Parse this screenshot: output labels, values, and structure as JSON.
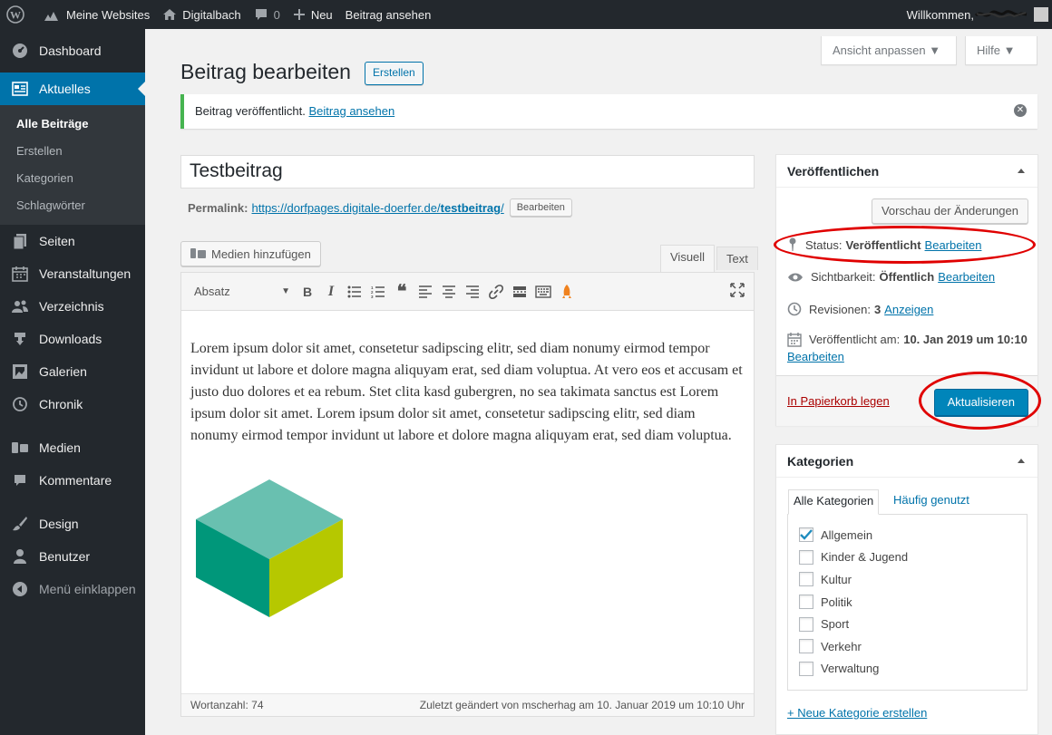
{
  "adminbar": {
    "my_sites": "Meine Websites",
    "site_name": "Digitalbach",
    "comments_count": "0",
    "new_label": "Neu",
    "view_post": "Beitrag ansehen",
    "greeting": "Willkommen,"
  },
  "sidebar": {
    "dashboard": "Dashboard",
    "posts": "Aktuelles",
    "sub": [
      "Alle Beiträge",
      "Erstellen",
      "Kategorien",
      "Schlagwörter"
    ],
    "pages": "Seiten",
    "events": "Veranstaltungen",
    "directory": "Verzeichnis",
    "downloads": "Downloads",
    "galleries": "Galerien",
    "chronicle": "Chronik",
    "media": "Medien",
    "comments": "Kommentare",
    "design": "Design",
    "users": "Benutzer",
    "collapse": "Menü einklappen"
  },
  "screen_options": "Ansicht anpassen",
  "help": "Hilfe",
  "page_title": "Beitrag bearbeiten",
  "title_action": "Erstellen",
  "notice": {
    "text": "Beitrag veröffentlicht.",
    "link": "Beitrag ansehen"
  },
  "post": {
    "title": "Testbeitrag",
    "permalink_label": "Permalink:",
    "permalink_base": "https://dorfpages.digitale-doerfer.de/",
    "permalink_slug": "testbeitrag",
    "permalink_tail": "/",
    "permalink_edit": "Bearbeiten"
  },
  "editor": {
    "add_media": "Medien hinzufügen",
    "tab_visual": "Visuell",
    "tab_text": "Text",
    "format": "Absatz",
    "content": "Lorem ipsum dolor sit amet, consetetur sadipscing elitr, sed diam nonumy eirmod tempor invidunt ut labore et dolore magna aliquyam erat, sed diam voluptua. At vero eos et accusam et justo duo dolores et ea rebum. Stet clita kasd gubergren, no sea takimata sanctus est Lorem ipsum dolor sit amet. Lorem ipsum dolor sit amet, consetetur sadipscing elitr, sed diam nonumy eirmod tempor invidunt ut labore et dolore magna aliquyam erat, sed diam voluptua.",
    "word_count": "Wortanzahl: 74",
    "last_edited": "Zuletzt geändert von mscherhag am 10. Januar 2019 um 10:10 Uhr"
  },
  "publish": {
    "heading": "Veröffentlichen",
    "preview": "Vorschau der Änderungen",
    "status_label": "Status:",
    "status_value": "Veröffentlicht",
    "visibility_label": "Sichtbarkeit:",
    "visibility_value": "Öffentlich",
    "revisions_label": "Revisionen:",
    "revisions_value": "3",
    "revisions_link": "Anzeigen",
    "published_label": "Veröffentlicht am:",
    "published_value": "10. Jan 2019 um 10:10",
    "edit": "Bearbeiten",
    "trash": "In Papierkorb legen",
    "update": "Aktualisieren"
  },
  "categories": {
    "heading": "Kategorien",
    "tab_all": "Alle Kategorien",
    "tab_popular": "Häufig genutzt",
    "items": [
      {
        "label": "Allgemein",
        "checked": true
      },
      {
        "label": "Kinder & Jugend",
        "checked": false
      },
      {
        "label": "Kultur",
        "checked": false
      },
      {
        "label": "Politik",
        "checked": false
      },
      {
        "label": "Sport",
        "checked": false
      },
      {
        "label": "Verkehr",
        "checked": false
      },
      {
        "label": "Verwaltung",
        "checked": false
      }
    ],
    "add_new": "+ Neue Kategorie erstellen"
  },
  "colors": {
    "accent": "#0073aa",
    "annotation": "#e00000",
    "cube_top": "#69c0b0",
    "cube_left": "#00977a",
    "cube_right": "#b6c800"
  }
}
